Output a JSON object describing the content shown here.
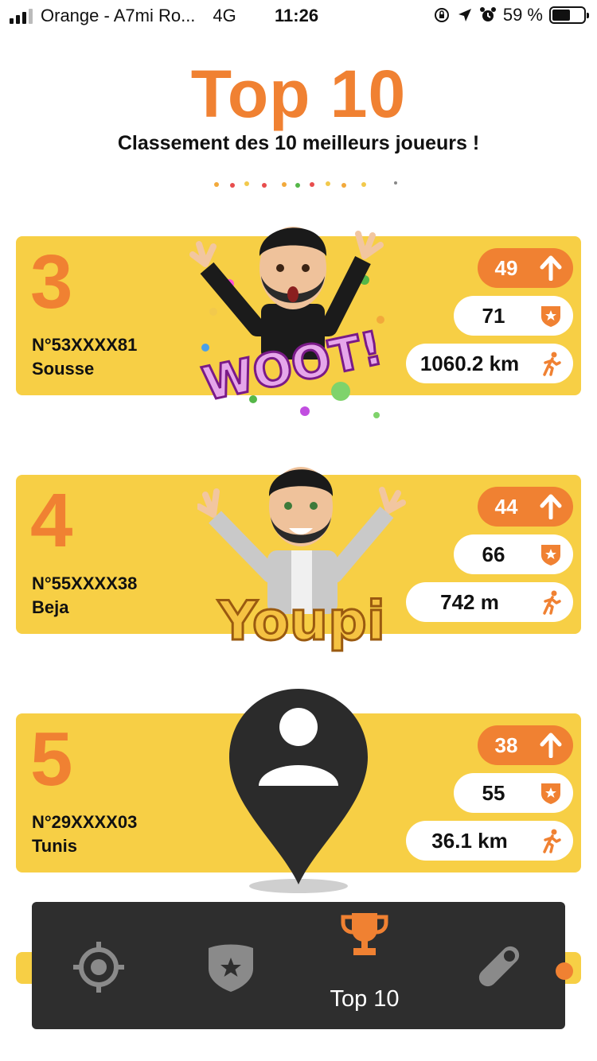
{
  "status_bar": {
    "carrier": "Orange - A7mi Ro...",
    "network": "4G",
    "time": "11:26",
    "battery": "59 %",
    "battery_level": 0.59
  },
  "header": {
    "title": "Top 10",
    "subtitle": "Classement des 10 meilleurs joueurs !"
  },
  "players": [
    {
      "rank": "3",
      "id": "N°53XXXX81",
      "city": "Sousse",
      "score": "49",
      "badges": "71",
      "distance": "1060.2 km",
      "avatar": "woot-bitmoji"
    },
    {
      "rank": "4",
      "id": "N°55XXXX38",
      "city": "Beja",
      "score": "44",
      "badges": "66",
      "distance": "742 m",
      "avatar": "youpi-bitmoji"
    },
    {
      "rank": "5",
      "id": "N°29XXXX03",
      "city": "Tunis",
      "score": "38",
      "badges": "55",
      "distance": "36.1 km",
      "avatar": "default-user-pin"
    }
  ],
  "stickers": {
    "woot_text": "WOOT!",
    "youpi_text": "Youpi"
  },
  "bottom_nav": {
    "items": [
      {
        "icon": "crosshair-icon",
        "label": "",
        "active": false
      },
      {
        "icon": "shield-star-icon",
        "label": "",
        "active": false
      },
      {
        "icon": "trophy-icon",
        "label": "Top 10",
        "active": true
      },
      {
        "icon": "pill-toggle-icon",
        "label": "",
        "active": false
      }
    ]
  },
  "colors": {
    "accent": "#f08132",
    "card": "#f7cf45",
    "nav_bg": "#2e2e2e",
    "inactive_icon": "#8a8a8a"
  }
}
